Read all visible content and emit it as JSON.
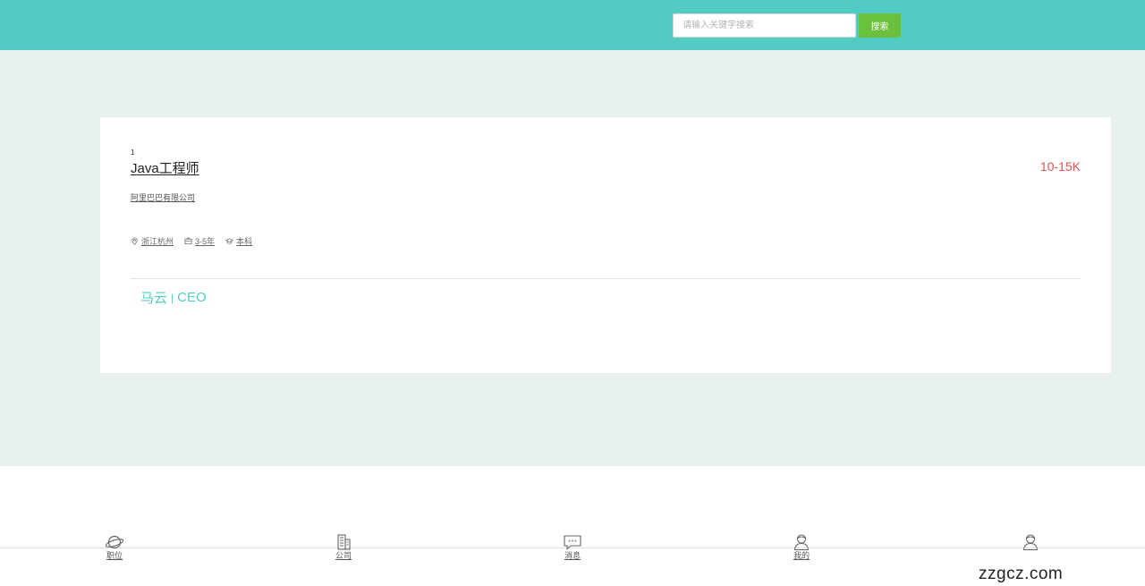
{
  "header": {
    "search_placeholder": "请输入关键字搜索",
    "search_button": "搜索",
    "accent_color": "#52cbc4",
    "button_color": "#6bc13c"
  },
  "job": {
    "index": "1",
    "title": "Java工程师",
    "salary": "10-15K",
    "company": "阿里巴巴有限公司",
    "tags": {
      "location": "浙江杭州",
      "experience": "3-5年",
      "education": "本科"
    },
    "contact": {
      "name": "马云",
      "separator": "|",
      "role": "CEO"
    },
    "salary_color": "#d9534f"
  },
  "tabbar": {
    "items": [
      {
        "label": "职位",
        "icon": "planet-icon"
      },
      {
        "label": "公司",
        "icon": "building-icon"
      },
      {
        "label": "消息",
        "icon": "chat-icon"
      },
      {
        "label": "我的",
        "icon": "user-icon"
      },
      {
        "label": "",
        "icon": "user-icon"
      }
    ]
  },
  "watermark": "zzgcz.com"
}
